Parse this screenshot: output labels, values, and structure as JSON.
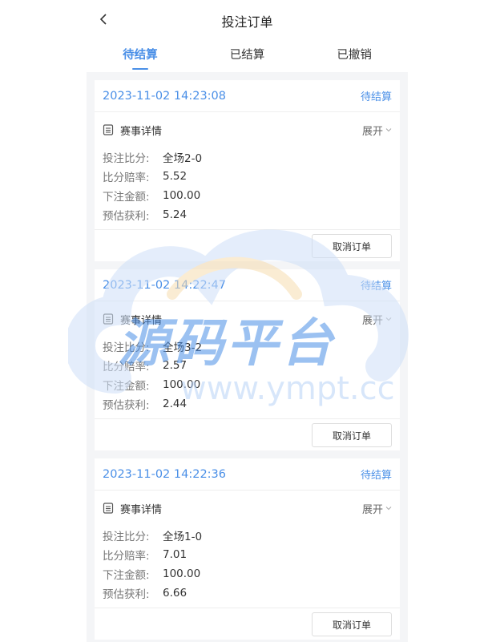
{
  "header": {
    "title": "投注订单",
    "back_icon": "chevron-left-icon"
  },
  "tabs": [
    {
      "label": "待结算",
      "active": true
    },
    {
      "label": "已结算",
      "active": false
    },
    {
      "label": "已撤销",
      "active": false
    }
  ],
  "labels": {
    "detail_title": "赛事详情",
    "expand": "展开",
    "score": "投注比分:",
    "odds": "比分赔率:",
    "amount": "下注金额:",
    "profit": "预估获利:",
    "cancel": "取消订单"
  },
  "orders": [
    {
      "time": "2023-11-02 14:23:08",
      "status": "待结算",
      "score": "全场2-0",
      "odds": "5.52",
      "amount": "100.00",
      "profit": "5.24"
    },
    {
      "time": "2023-11-02 14:22:47",
      "status": "待结算",
      "score": "全场3-2",
      "odds": "2.57",
      "amount": "100.00",
      "profit": "2.44"
    },
    {
      "time": "2023-11-02 14:22:36",
      "status": "待结算",
      "score": "全场1-0",
      "odds": "7.01",
      "amount": "100.00",
      "profit": "6.66"
    }
  ],
  "watermark": {
    "name": "源码平台",
    "url": "www.ympt.cc"
  },
  "colors": {
    "accent": "#4a8fe7",
    "background": "#f4f5f7"
  }
}
